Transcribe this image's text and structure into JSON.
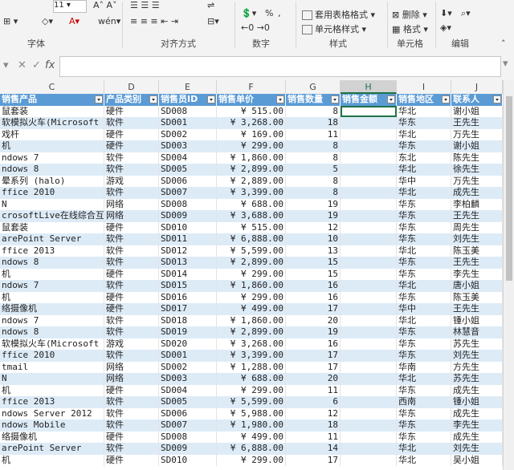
{
  "ribbon": {
    "font_size": "11",
    "font_label": "字体",
    "align_label": "对齐方式",
    "number_label": "数字",
    "style_label": "样式",
    "cells_label": "单元格",
    "edit_label": "编辑",
    "percent": "%",
    "comma": ",",
    "table_format": "套用表格格式",
    "cell_styles": "单元格样式",
    "delete": "删除",
    "format": "格式"
  },
  "formula_bar": {
    "x": "✕",
    "check": "✓",
    "fx": "fx",
    "value": ""
  },
  "columns": [
    "C",
    "D",
    "E",
    "F",
    "G",
    "H",
    "I",
    "J"
  ],
  "selected_column": "H",
  "header_row": [
    "销售产品",
    "产品类别",
    "销售员ID",
    "销售单价",
    "销售数量",
    "销售金额",
    "销售地区",
    "联系人"
  ],
  "rows": [
    [
      "鼠套装",
      "硬件",
      "SD008",
      "¥    515.00",
      "8",
      "",
      "华北",
      "谢小姐"
    ],
    [
      "软模拟火车(Microsoft",
      "软件",
      "SD001",
      "¥  3,268.00",
      "18",
      "",
      "华东",
      "王先生"
    ],
    [
      "戏杆",
      "硬件",
      "SD002",
      "¥    169.00",
      "11",
      "",
      "华北",
      "万先生"
    ],
    [
      "机",
      "硬件",
      "SD003",
      "¥    299.00",
      "8",
      "",
      "华东",
      "谢小姐"
    ],
    [
      "ndows 7",
      "软件",
      "SD004",
      "¥  1,860.00",
      "8",
      "",
      "东北",
      "陈先生"
    ],
    [
      "ndows 8",
      "软件",
      "SD005",
      "¥  2,899.00",
      "5",
      "",
      "华北",
      "徐先生"
    ],
    [
      "晕系列 (halo)",
      "游戏",
      "SD006",
      "¥  2,889.00",
      "8",
      "",
      "华中",
      "万先生"
    ],
    [
      "ffice 2010",
      "软件",
      "SD007",
      "¥  3,399.00",
      "8",
      "",
      "华北",
      "成先生"
    ],
    [
      "N",
      "网络",
      "SD008",
      "¥    688.00",
      "19",
      "",
      "华东",
      "李柏麟"
    ],
    [
      "crosoftLive在线综合互",
      "网络",
      "SD009",
      "¥  3,688.00",
      "19",
      "",
      "华东",
      "王先生"
    ],
    [
      "鼠套装",
      "硬件",
      "SD010",
      "¥    515.00",
      "12",
      "",
      "华东",
      "周先生"
    ],
    [
      "arePoint Server",
      "软件",
      "SD011",
      "¥  6,888.00",
      "10",
      "",
      "华东",
      "刘先生"
    ],
    [
      "ffice 2013",
      "软件",
      "SD012",
      "¥  5,599.00",
      "13",
      "",
      "华北",
      "陈玉美"
    ],
    [
      "ndows 8",
      "软件",
      "SD013",
      "¥  2,899.00",
      "15",
      "",
      "华东",
      "王先生"
    ],
    [
      "机",
      "硬件",
      "SD014",
      "¥    299.00",
      "15",
      "",
      "华东",
      "李先生"
    ],
    [
      "ndows 7",
      "软件",
      "SD015",
      "¥  1,860.00",
      "16",
      "",
      "华北",
      "唐小姐"
    ],
    [
      "机",
      "硬件",
      "SD016",
      "¥    299.00",
      "16",
      "",
      "华东",
      "陈玉美"
    ],
    [
      "络摄像机",
      "硬件",
      "SD017",
      "¥    499.00",
      "17",
      "",
      "华中",
      "王先生"
    ],
    [
      "ndows 7",
      "软件",
      "SD018",
      "¥  1,860.00",
      "20",
      "",
      "华北",
      "锺小姐"
    ],
    [
      "ndows 8",
      "软件",
      "SD019",
      "¥  2,899.00",
      "19",
      "",
      "华东",
      "林慧音"
    ],
    [
      "软模拟火车(Microsoft",
      "游戏",
      "SD020",
      "¥  3,268.00",
      "16",
      "",
      "华东",
      "苏先生"
    ],
    [
      "ffice 2010",
      "软件",
      "SD001",
      "¥  3,399.00",
      "17",
      "",
      "华东",
      "刘先生"
    ],
    [
      "tmail",
      "网络",
      "SD002",
      "¥  1,288.00",
      "17",
      "",
      "华南",
      "方先生"
    ],
    [
      "N",
      "网络",
      "SD003",
      "¥    688.00",
      "20",
      "",
      "华北",
      "苏先生"
    ],
    [
      "机",
      "硬件",
      "SD004",
      "¥    299.00",
      "11",
      "",
      "华东",
      "成先生"
    ],
    [
      "ffice 2013",
      "软件",
      "SD005",
      "¥  5,599.00",
      "6",
      "",
      "西南",
      "锺小姐"
    ],
    [
      "ndows Server 2012",
      "软件",
      "SD006",
      "¥  5,988.00",
      "12",
      "",
      "华东",
      "成先生"
    ],
    [
      "ndows Mobile",
      "软件",
      "SD007",
      "¥  1,980.00",
      "18",
      "",
      "华东",
      "李先生"
    ],
    [
      "络摄像机",
      "硬件",
      "SD008",
      "¥    499.00",
      "11",
      "",
      "华东",
      "成先生"
    ],
    [
      "arePoint Server",
      "软件",
      "SD009",
      "¥  6,888.00",
      "14",
      "",
      "华北",
      "刘先生"
    ],
    [
      "机",
      "硬件",
      "SD010",
      "¥    299.00",
      "17",
      "",
      "华北",
      "吴小姐"
    ]
  ]
}
